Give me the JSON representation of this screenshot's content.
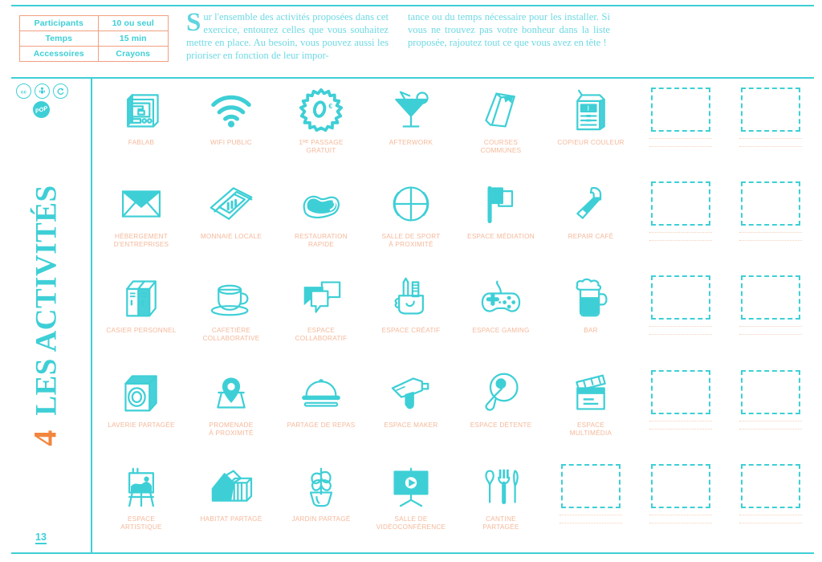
{
  "meta": {
    "section_number": "4",
    "section_title": "LES ACTIVITÉS",
    "page_number": "13"
  },
  "info_table": {
    "rows": [
      {
        "key": "Participants",
        "value": "10 ou seul"
      },
      {
        "key": "Temps",
        "value": "15 min"
      },
      {
        "key": "Accessoires",
        "value": "Crayons"
      }
    ]
  },
  "intro": {
    "dropcap": "S",
    "left_text": "ur l'ensemble des activités proposées dans cet exercice, entourez celles que vous souhaitez mettre en place. Au besoin, vous pouvez aussi les prioriser en fonction de leur impor-",
    "right_text": "tance ou du temps nécessaire pour les installer. Si vous ne trouvez pas votre bonheur dans la liste proposée, rajoutez tout ce que vous avez en tête !"
  },
  "license": {
    "badges": [
      "cc-icon",
      "by-person-icon",
      "share-alike-icon"
    ],
    "pop_label": "POP"
  },
  "colors": {
    "teal": "#3ecfd6",
    "teal_light": "#6fd9e4",
    "salmon": "#f5b89a",
    "orange": "#f2863f",
    "table_border": "#f0a080",
    "dotted": "#f7cfb9"
  },
  "grid": {
    "columns": 8,
    "rows": 5,
    "cells": [
      {
        "icon": "fablab-3d-printer-icon",
        "label": "FABLAB"
      },
      {
        "icon": "wifi-icon",
        "label": "WIFI PUBLIC"
      },
      {
        "icon": "free-first-pass-badge-icon",
        "label": "1ᴿᴱ PASSAGE\nGRATUIT"
      },
      {
        "icon": "cocktail-glass-icon",
        "label": "AFTERWORK"
      },
      {
        "icon": "books-icon",
        "label": "COURSES\nCOMMUNES"
      },
      {
        "icon": "color-copier-icon",
        "label": "COPIEUR COULEUR"
      },
      {
        "icon": "empty-placeholder",
        "label": ""
      },
      {
        "icon": "empty-placeholder",
        "label": ""
      },
      {
        "icon": "envelope-icon",
        "label": "HÉBERGEMENT\nD'ENTREPRISES"
      },
      {
        "icon": "banknotes-icon",
        "label": "MONNAIE LOCALE"
      },
      {
        "icon": "hotdog-icon",
        "label": "RESTAURATION\nRAPIDE"
      },
      {
        "icon": "basketball-icon",
        "label": "SALLE DE SPORT\nÀ PROXIMITÉ"
      },
      {
        "icon": "flag-icon",
        "label": "ESPACE MÉDIATION"
      },
      {
        "icon": "hammer-icon",
        "label": "REPAIR CAFÉ"
      },
      {
        "icon": "empty-placeholder",
        "label": ""
      },
      {
        "icon": "empty-placeholder",
        "label": ""
      },
      {
        "icon": "lockers-icon",
        "label": "CASIER PERSONNEL"
      },
      {
        "icon": "coffee-cup-icon",
        "label": "CAFETIÈRE\nCOLLABORATIVE"
      },
      {
        "icon": "speech-bubbles-icon",
        "label": "ESPACE\nCOLLABORATIF"
      },
      {
        "icon": "art-supplies-pocket-icon",
        "label": "ESPACE CRÉATIF"
      },
      {
        "icon": "gamepad-icon",
        "label": "ESPACE GAMING"
      },
      {
        "icon": "beer-mug-icon",
        "label": "BAR"
      },
      {
        "icon": "empty-placeholder",
        "label": ""
      },
      {
        "icon": "empty-placeholder",
        "label": ""
      },
      {
        "icon": "washing-machine-icon",
        "label": "LAVERIE PARTAGÉE"
      },
      {
        "icon": "map-pin-icon",
        "label": "PROMENADE\nÀ PROXIMITÉ"
      },
      {
        "icon": "food-cloche-icon",
        "label": "PARTAGE DE REPAS"
      },
      {
        "icon": "power-drill-icon",
        "label": "ESPACE MAKER"
      },
      {
        "icon": "ping-pong-paddle-icon",
        "label": "ESPACE DÉTENTE"
      },
      {
        "icon": "clapperboard-icon",
        "label": "ESPACE\nMULTIMÉDIA"
      },
      {
        "icon": "empty-placeholder",
        "label": ""
      },
      {
        "icon": "empty-placeholder",
        "label": ""
      },
      {
        "icon": "easel-painting-icon",
        "label": "ESPACE\nARTISTIQUE"
      },
      {
        "icon": "shared-housing-icon",
        "label": "HABITAT PARTAGÉ"
      },
      {
        "icon": "potted-plant-icon",
        "label": "JARDIN PARTAGÉ"
      },
      {
        "icon": "video-presentation-icon",
        "label": "SALLE DE\nVIDÉOCONFÉRENCE"
      },
      {
        "icon": "cutlery-icon",
        "label": "CANTINE\nPARTAGÉE"
      },
      {
        "icon": "empty-placeholder",
        "label": ""
      },
      {
        "icon": "empty-placeholder",
        "label": ""
      },
      {
        "icon": "empty-placeholder",
        "label": ""
      }
    ]
  }
}
